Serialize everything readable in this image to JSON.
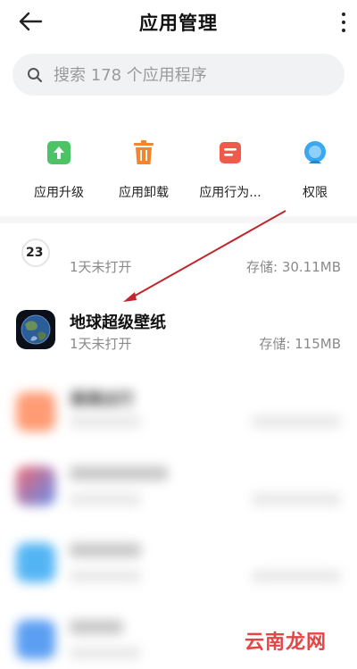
{
  "header": {
    "title": "应用管理"
  },
  "search": {
    "placeholder": "搜索 178 个应用程序"
  },
  "quick_actions": [
    {
      "label": "应用升级",
      "icon": "upgrade-icon",
      "color": "#4cc466"
    },
    {
      "label": "应用卸载",
      "icon": "trash-icon",
      "color": "#f5852d"
    },
    {
      "label": "应用行为...",
      "icon": "behavior-icon",
      "color": "#f05a4a"
    },
    {
      "label": "权限",
      "icon": "permission-icon",
      "color": "#3aa8f0"
    }
  ],
  "apps": [
    {
      "name": "",
      "last_opened": "1天未打开",
      "size": "存储: 30.11MB",
      "icon_badge": "23"
    },
    {
      "name": "地球超级壁纸",
      "last_opened": "1天未打开",
      "size": "存储: 115MB",
      "icon": "earth-icon"
    },
    {
      "name": "滴滴出行",
      "last_opened": "",
      "size": ""
    },
    {
      "name": "",
      "last_opened": "",
      "size": ""
    },
    {
      "name": "",
      "last_opened": "",
      "size": ""
    },
    {
      "name": "",
      "last_opened": "",
      "size": ""
    }
  ],
  "watermark": "云南龙网",
  "colors": {
    "accent_arrow": "#c0262b",
    "background": "#ffffff",
    "secondary_text": "#8a8a8a"
  }
}
